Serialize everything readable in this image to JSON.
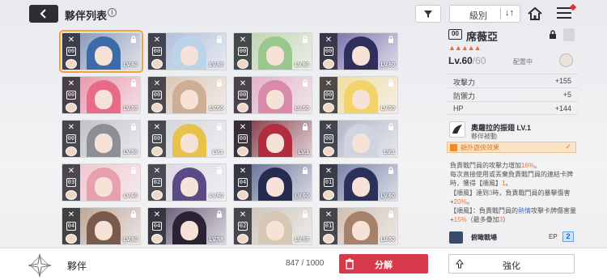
{
  "header": {
    "title": "夥伴列表",
    "sort_label": "級別",
    "sort_toggle": "↓↑"
  },
  "characters": [
    {
      "lv": "LV.60",
      "rank": "00",
      "hair": "#3d6aa8",
      "bg": "#7c8fb4",
      "selected": true
    },
    {
      "lv": "LV.60",
      "rank": "00",
      "hair": "#bcd4e8",
      "bg": "#a7b8d8"
    },
    {
      "lv": "LV.60",
      "rank": "00",
      "hair": "#9bc78e",
      "bg": "#b8d3a6"
    },
    {
      "lv": "LV.60",
      "rank": "00",
      "hair": "#2e2f5a",
      "bg": "#6c63a5"
    },
    {
      "lv": "LV.60",
      "rank": "00",
      "hair": "#e86b8a",
      "bg": "#e88aa2"
    },
    {
      "lv": "LV.50",
      "rank": "00",
      "hair": "#cfae96",
      "bg": "#d8c1ae"
    },
    {
      "lv": "LV.50",
      "rank": "00",
      "hair": "#d98aa8",
      "bg": "#e0a9bf"
    },
    {
      "lv": "LV.50",
      "rank": "00",
      "hair": "#f2d36a",
      "bg": "#f0d998"
    },
    {
      "lv": "LV.50",
      "rank": "00",
      "hair": "#8d8f96",
      "bg": "#b9bbc1"
    },
    {
      "lv": "LV.1",
      "rank": "00",
      "hair": "#e8c24a",
      "bg": "#cfd2d8"
    },
    {
      "lv": "LV.1",
      "rank": "00",
      "hair": "#b32b3e",
      "bg": "#7a2a38"
    },
    {
      "lv": "LV.1",
      "rank": "00",
      "hair": "#cfd4e0",
      "bg": "#a9aec0"
    },
    {
      "lv": "LV.60",
      "rank": "03",
      "hair": "#e7a0ae",
      "bg": "#f1c0ca"
    },
    {
      "lv": "LV.60",
      "rank": "02",
      "hair": "#5a4b86",
      "bg": "#d9d4e4"
    },
    {
      "lv": "LV.60",
      "rank": "04",
      "hair": "#252c50",
      "bg": "#59648f"
    },
    {
      "lv": "LV.60",
      "rank": "01",
      "hair": "#2b3158",
      "bg": "#6a74a0"
    },
    {
      "lv": "LV.60",
      "rank": "04",
      "hair": "#7a5b4b",
      "bg": "#b89c88"
    },
    {
      "lv": "LV.58",
      "rank": "04",
      "hair": "#2b2333",
      "bg": "#5c4f6e"
    },
    {
      "lv": "LV.55",
      "rank": "02",
      "hair": "#d7c8b6",
      "bg": "#c9bfb3"
    },
    {
      "lv": "LV.50",
      "rank": "01",
      "hair": "#a7826a",
      "bg": "#cbb7a8"
    }
  ],
  "detail": {
    "rank": "00",
    "name": "席薇亞",
    "stars": "▲▲▲▲▲",
    "level": "Lv.60",
    "level_max": "/60",
    "assign_label": "配置中",
    "stats": [
      {
        "k": "攻擊力",
        "v": "+155"
      },
      {
        "k": "防禦力",
        "v": "+5"
      },
      {
        "k": "HP",
        "v": "+144"
      }
    ],
    "skill_name": "奧蘿拉的振翅 LV.1",
    "skill_type": "夥伴被動",
    "bonus_label": "額外遊俠效果",
    "bonus_check": "✓",
    "desc_1": "負責戰鬥員的攻擊力增加",
    "desc_1_val": "16%",
    "desc_1_end": "。",
    "desc_2": "每次直接使用或丟棄負責戰鬥員的連結卡牌時，獲得【順風】",
    "desc_2_val": "1",
    "desc_2_end": "。",
    "desc_3": "【順風】達到",
    "desc_3_val": "3",
    "desc_3_mid": "時，負責戰鬥員的暴擊傷害+",
    "desc_3_val2": "20%",
    "desc_3_end": "。",
    "desc_4": "【順風】：負責戰鬥員的",
    "desc_4_blue": "熱情",
    "desc_4_mid": "攻擊卡牌傷害量+",
    "desc_4_val": "15%",
    "desc_4_mid2": "（最多疊加",
    "desc_4_val2": "3",
    "desc_4_end": "）",
    "sub_skill_name": "俯瞰戰場",
    "ep_label": "EP",
    "ep_value": "2"
  },
  "footer": {
    "title": "夥伴",
    "count": "847 / 1000",
    "dismiss_label": "分解",
    "enhance_label": "強化"
  },
  "colors": {
    "accent_red": "#d8394a",
    "accent_orange": "#f06a2e",
    "ep_blue": "#2860c5"
  }
}
